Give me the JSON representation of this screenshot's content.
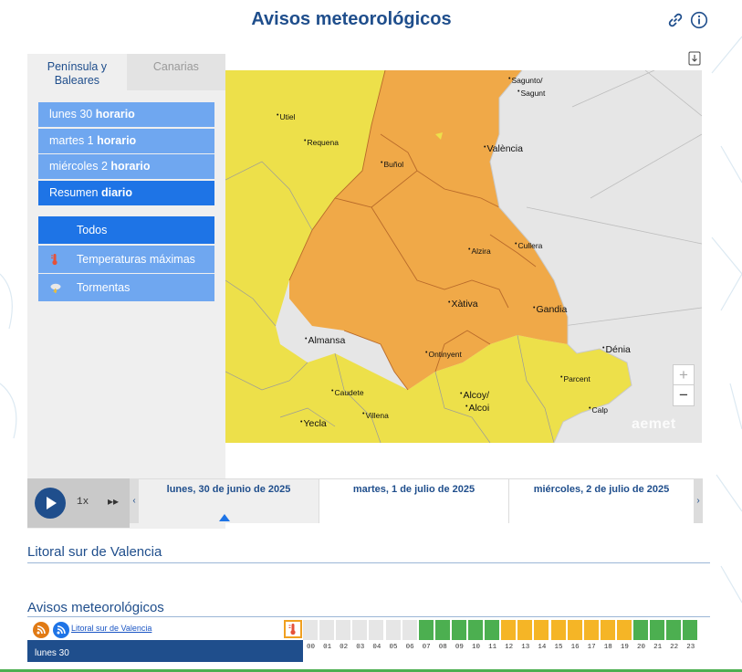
{
  "header": {
    "title": "Avisos meteorológicos",
    "icons": [
      "link-icon",
      "info-icon"
    ]
  },
  "region_tabs": [
    {
      "label": "Península y Baleares",
      "active": true
    },
    {
      "label": "Canarias",
      "active": false
    }
  ],
  "days": [
    {
      "prefix": "lunes 30",
      "suffix": "horario",
      "active": false
    },
    {
      "prefix": "martes 1",
      "suffix": "horario",
      "active": false
    },
    {
      "prefix": "miércoles 2",
      "suffix": "horario",
      "active": false
    },
    {
      "prefix": "Resumen",
      "suffix": "diario",
      "active": true
    }
  ],
  "filters": [
    {
      "label": "Todos",
      "icon": "",
      "active": true
    },
    {
      "label": "Temperaturas máximas",
      "icon": "thermometer-icon",
      "active": false
    },
    {
      "label": "Tormentas",
      "icon": "storm-icon",
      "active": false
    }
  ],
  "map": {
    "places": [
      {
        "name": "Sagunto/",
        "big": false
      },
      {
        "name": "Sagunt",
        "big": false
      },
      {
        "name": "Utiel",
        "big": false
      },
      {
        "name": "Requena",
        "big": false
      },
      {
        "name": "València",
        "big": true
      },
      {
        "name": "Buñol",
        "big": false
      },
      {
        "name": "Alzira",
        "big": false
      },
      {
        "name": "Cullera",
        "big": false
      },
      {
        "name": "Xàtiva",
        "big": true
      },
      {
        "name": "Gandia",
        "big": true
      },
      {
        "name": "Almansa",
        "big": true
      },
      {
        "name": "Ontinyent",
        "big": false
      },
      {
        "name": "Dénia",
        "big": true
      },
      {
        "name": "Parcent",
        "big": false
      },
      {
        "name": "Caudete",
        "big": false
      },
      {
        "name": "Alcoy/",
        "big": true
      },
      {
        "name": "Alcoi",
        "big": true
      },
      {
        "name": "Calp",
        "big": false
      },
      {
        "name": "Villena",
        "big": false
      },
      {
        "name": "Yecla",
        "big": true
      }
    ],
    "zoom_in": "+",
    "zoom_out": "−",
    "logo": "aemet",
    "colors": {
      "yellow": "#ede04a",
      "orange": "#f0a948",
      "sea": "#e6e6e6",
      "border": "#b86a2a"
    }
  },
  "player": {
    "speed": "1x",
    "fast_forward": "▸▸"
  },
  "timeline": {
    "prev": "‹",
    "next": "›",
    "days": [
      {
        "label": "lunes, 30 de junio de 2025",
        "selected": true
      },
      {
        "label": "martes, 1 de julio de 2025",
        "selected": false
      },
      {
        "label": "miércoles, 2 de julio de 2025",
        "selected": false
      }
    ]
  },
  "zone_title": "Litoral sur de Valencia",
  "avisos": {
    "title": "Avisos meteorológicos",
    "zone_link": "Litoral sur de Valencia",
    "day_label": "lunes 30",
    "hours": [
      "00",
      "01",
      "02",
      "03",
      "04",
      "05",
      "06",
      "07",
      "08",
      "09",
      "10",
      "11",
      "12",
      "13",
      "14",
      "15",
      "16",
      "17",
      "18",
      "19",
      "20",
      "21",
      "22",
      "23"
    ],
    "levels": [
      "none",
      "none",
      "none",
      "none",
      "none",
      "none",
      "none",
      "green",
      "green",
      "green",
      "green",
      "green",
      "yellow",
      "yellow",
      "yellow",
      "yellow",
      "yellow",
      "yellow",
      "yellow",
      "yellow",
      "green",
      "green",
      "green",
      "green"
    ],
    "level_colors": {
      "none": "#e6e6e6",
      "green": "#4caf50",
      "yellow": "#f5b526"
    }
  }
}
